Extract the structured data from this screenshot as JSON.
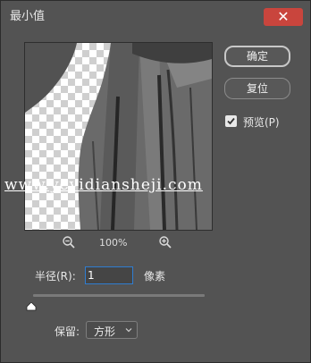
{
  "dialog": {
    "title": "最小值",
    "close_symbol": "✕"
  },
  "buttons": {
    "ok_label": "确定",
    "reset_label": "复位"
  },
  "preview_checkbox": {
    "label": "预览(P)",
    "checked": true
  },
  "zoom": {
    "level": "100%",
    "zoom_out_icon": "zoom-out-icon",
    "zoom_in_icon": "zoom-in-icon"
  },
  "watermark": "www.yeyidiansheji.com",
  "radius": {
    "label": "半径(R):",
    "value": "1",
    "unit": "像素",
    "slider_fraction": 0.0
  },
  "preserve": {
    "label": "保留:",
    "selected": "方形"
  }
}
